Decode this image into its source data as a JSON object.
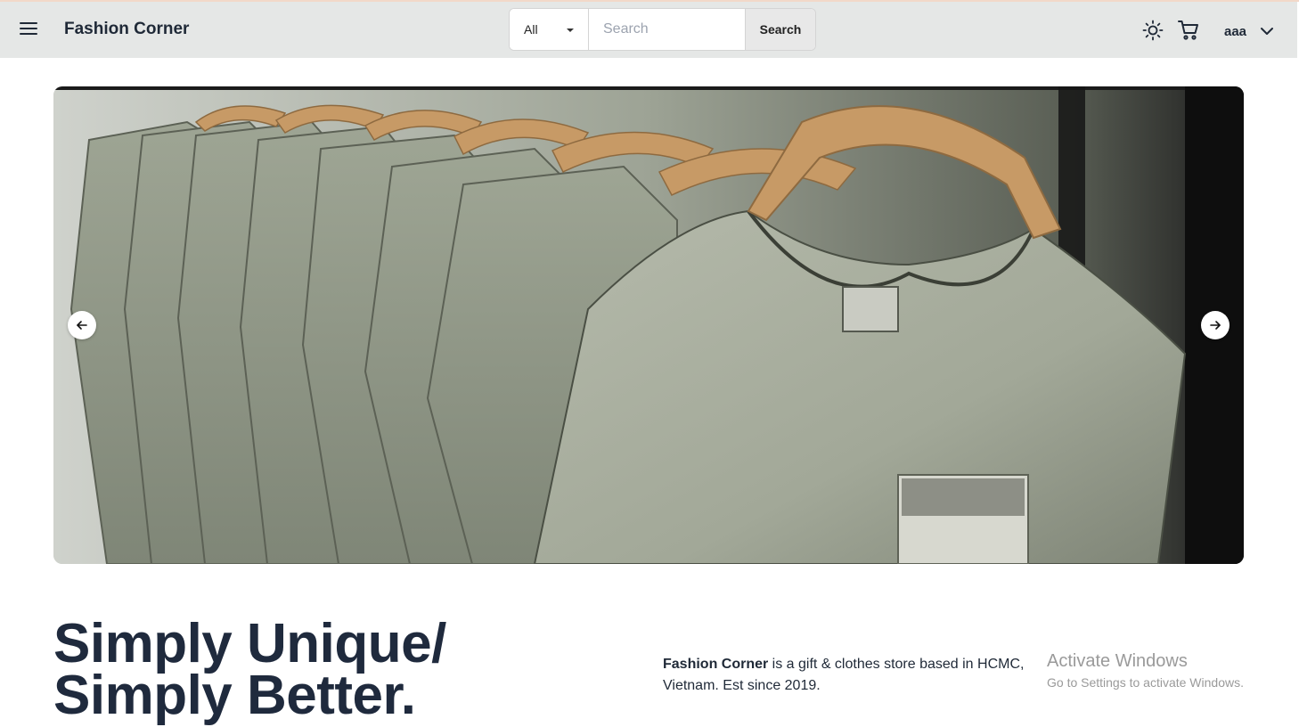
{
  "header": {
    "brand": "Fashion Corner",
    "category_select": {
      "value": "All"
    },
    "search": {
      "placeholder": "Search",
      "button_label": "Search"
    },
    "user": {
      "name": "aaa"
    },
    "icons": {
      "menu": "hamburger-menu-icon",
      "theme": "sun-icon",
      "cart": "cart-icon",
      "user_menu": "chevron-down-icon"
    }
  },
  "hero": {
    "icons": {
      "prev": "arrow-left-icon",
      "next": "arrow-right-icon"
    }
  },
  "intro": {
    "headline_line1": "Simply Unique/",
    "headline_line2": "Simply Better.",
    "about_brand": "Fashion Corner",
    "about_text": " is a gift & clothes store based in HCMC, Vietnam. Est since 2019."
  },
  "os_watermark": {
    "title": "Activate Windows",
    "subtitle": "Go to Settings to activate Windows."
  },
  "colors": {
    "navbar_bg": "#e5e7e6",
    "text_dark": "#1f2a3d",
    "shirt_green": "#8e9585",
    "hanger_wood": "#c79a66"
  }
}
